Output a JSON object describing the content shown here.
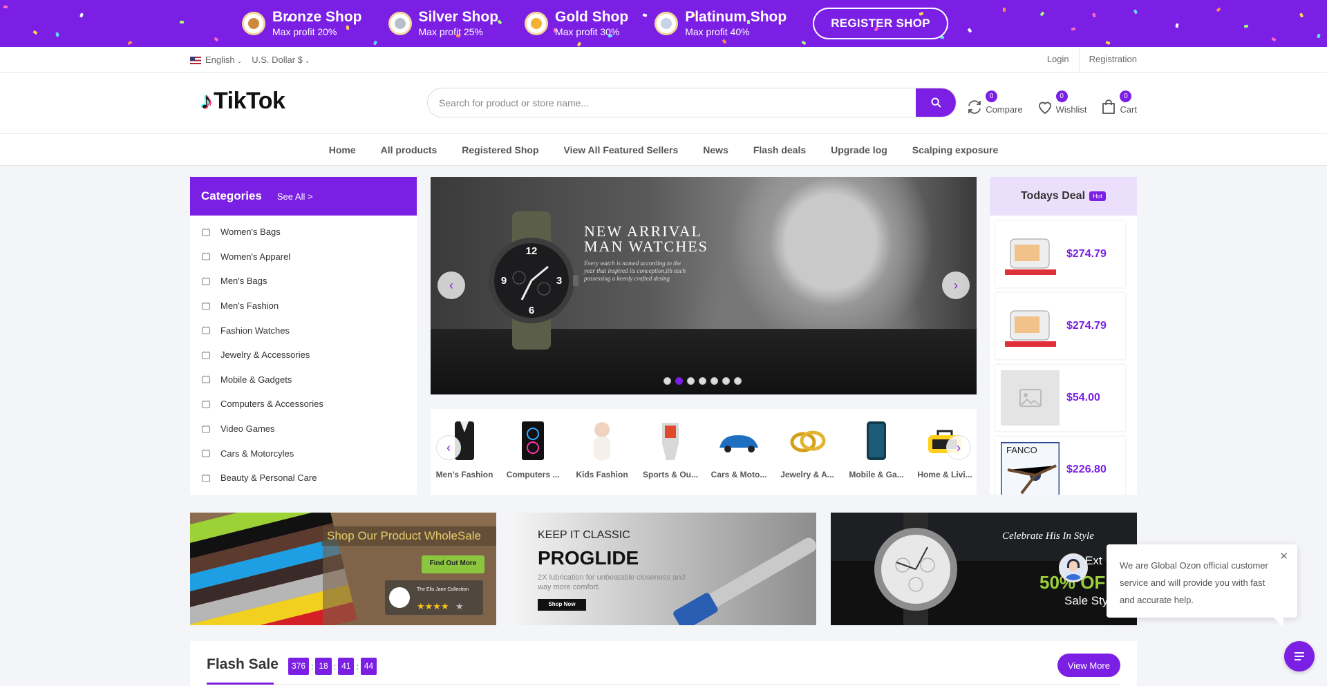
{
  "promo": {
    "tiers": [
      {
        "name": "Bronze Shop",
        "profit": "Max profit 20%",
        "color": "#cd8a3e"
      },
      {
        "name": "Silver Shop",
        "profit": "Max profit 25%",
        "color": "#b8c0cc"
      },
      {
        "name": "Gold Shop",
        "profit": "Max profit 30%",
        "color": "#f2b233"
      },
      {
        "name": "Platinum Shop",
        "profit": "Max profit 40%",
        "color": "#c9d2e6"
      }
    ],
    "register_label": "REGISTER SHOP"
  },
  "topbar": {
    "language": "English",
    "currency": "U.S. Dollar $",
    "login": "Login",
    "registration": "Registration"
  },
  "header": {
    "logo_text": "TikTok",
    "search_placeholder": "Search for product or store name...",
    "compare": {
      "label": "Compare",
      "count": "0"
    },
    "wishlist": {
      "label": "Wishlist",
      "count": "0"
    },
    "cart": {
      "label": "Cart",
      "count": "0"
    }
  },
  "nav": [
    "Home",
    "All products",
    "Registered Shop",
    "View All Featured Sellers",
    "News",
    "Flash deals",
    "Upgrade log",
    "Scalping exposure"
  ],
  "categories": {
    "title": "Categories",
    "see_all": "See All >",
    "items": [
      "Women's Bags",
      "Women's Apparel",
      "Men's Bags",
      "Men's Fashion",
      "Fashion Watches",
      "Jewelry & Accessories",
      "Mobile & Gadgets",
      "Computers & Accessories",
      "Video Games",
      "Cars & Motorcyles",
      "Beauty & Personal Care"
    ]
  },
  "hero": {
    "title_line1": "NEW ARRIVAL",
    "title_line2": "MAN WATCHES",
    "subtitle": "Every watch is named according to the year that inspired its conception,ith each possessing a keenly crafted desing",
    "slide_count": 7,
    "active_slide": 2
  },
  "carousel": [
    "Men's Fashion",
    "Computers ...",
    "Kids Fashion",
    "Sports & Ou...",
    "Cars & Moto...",
    "Jewelry & A...",
    "Mobile & Ga...",
    "Home & Livi..."
  ],
  "deals": {
    "title": "Todays Deal",
    "badge": "Hot",
    "items": [
      {
        "price": "$274.79",
        "thumb_label": "Air fryer"
      },
      {
        "price": "$274.79",
        "thumb_label": "Air fryer"
      },
      {
        "price": "$54.00",
        "thumb_label": "Placeholder"
      },
      {
        "price": "$226.80",
        "thumb_label": "FANCO"
      }
    ]
  },
  "banners": {
    "b1": {
      "title": "Shop Our Product WholeSale",
      "cta": "Find Out More",
      "brand": "The Elis Jane Collection"
    },
    "b2": {
      "kicker": "KEEP IT CLASSIC",
      "title": "PROGLIDE",
      "desc": "2X lubrication for unbeatable closeness and way more comfort.",
      "cta": "Shop Now"
    },
    "b3": {
      "script": "Celebrate His In Style",
      "ext": "Ext",
      "discount": "50% OF",
      "sale": "Sale Sty"
    }
  },
  "flash_sale": {
    "title": "Flash Sale",
    "timer": [
      "376",
      "18",
      "41",
      "44"
    ],
    "view_more": "View More"
  },
  "chat": {
    "message": "We are Global Ozon official customer service and will provide you with fast and accurate help."
  },
  "colors": {
    "accent": "#7b1fe4",
    "price": "#7b1fe4"
  }
}
